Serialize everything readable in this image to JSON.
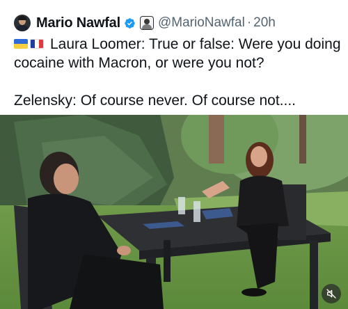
{
  "post": {
    "author": {
      "display_name": "Mario Nawfal",
      "handle": "@MarioNawfal",
      "separator": "·",
      "timestamp": "20h",
      "verified_color": "#1d9bf0"
    },
    "text": {
      "line1": "Laura Loomer: True or false: Were you doing",
      "line2": "cocaine with Macron, or were you not?",
      "line3": "Zelensky: Of course never. Of course not....",
      "flag_icons": [
        "ukraine-flag-icon",
        "france-flag-icon"
      ]
    },
    "media": {
      "type": "video",
      "mute_icon": "muted-speaker-icon"
    }
  },
  "colors": {
    "text": "#0f1419",
    "secondary": "#536471",
    "accent": "#1d9bf0"
  }
}
